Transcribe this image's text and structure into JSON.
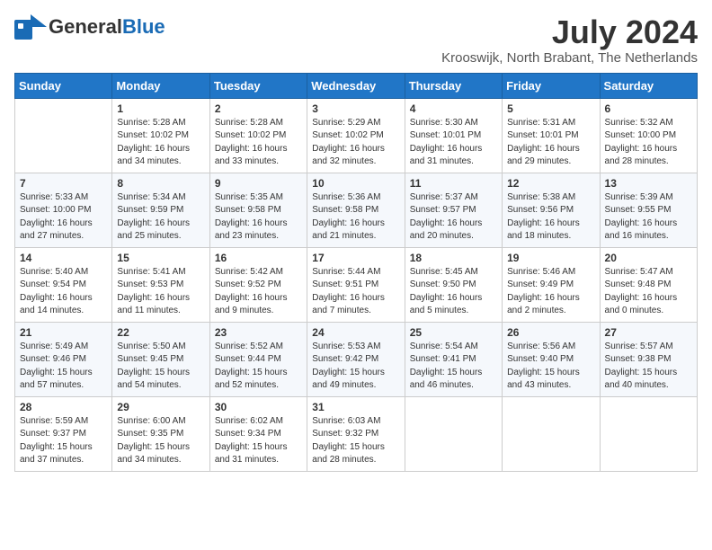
{
  "header": {
    "logo_general": "General",
    "logo_blue": "Blue",
    "month_year": "July 2024",
    "location": "Krooswijk, North Brabant, The Netherlands"
  },
  "weekdays": [
    "Sunday",
    "Monday",
    "Tuesday",
    "Wednesday",
    "Thursday",
    "Friday",
    "Saturday"
  ],
  "weeks": [
    [
      {
        "day": "",
        "text": ""
      },
      {
        "day": "1",
        "text": "Sunrise: 5:28 AM\nSunset: 10:02 PM\nDaylight: 16 hours\nand 34 minutes."
      },
      {
        "day": "2",
        "text": "Sunrise: 5:28 AM\nSunset: 10:02 PM\nDaylight: 16 hours\nand 33 minutes."
      },
      {
        "day": "3",
        "text": "Sunrise: 5:29 AM\nSunset: 10:02 PM\nDaylight: 16 hours\nand 32 minutes."
      },
      {
        "day": "4",
        "text": "Sunrise: 5:30 AM\nSunset: 10:01 PM\nDaylight: 16 hours\nand 31 minutes."
      },
      {
        "day": "5",
        "text": "Sunrise: 5:31 AM\nSunset: 10:01 PM\nDaylight: 16 hours\nand 29 minutes."
      },
      {
        "day": "6",
        "text": "Sunrise: 5:32 AM\nSunset: 10:00 PM\nDaylight: 16 hours\nand 28 minutes."
      }
    ],
    [
      {
        "day": "7",
        "text": "Sunrise: 5:33 AM\nSunset: 10:00 PM\nDaylight: 16 hours\nand 27 minutes."
      },
      {
        "day": "8",
        "text": "Sunrise: 5:34 AM\nSunset: 9:59 PM\nDaylight: 16 hours\nand 25 minutes."
      },
      {
        "day": "9",
        "text": "Sunrise: 5:35 AM\nSunset: 9:58 PM\nDaylight: 16 hours\nand 23 minutes."
      },
      {
        "day": "10",
        "text": "Sunrise: 5:36 AM\nSunset: 9:58 PM\nDaylight: 16 hours\nand 21 minutes."
      },
      {
        "day": "11",
        "text": "Sunrise: 5:37 AM\nSunset: 9:57 PM\nDaylight: 16 hours\nand 20 minutes."
      },
      {
        "day": "12",
        "text": "Sunrise: 5:38 AM\nSunset: 9:56 PM\nDaylight: 16 hours\nand 18 minutes."
      },
      {
        "day": "13",
        "text": "Sunrise: 5:39 AM\nSunset: 9:55 PM\nDaylight: 16 hours\nand 16 minutes."
      }
    ],
    [
      {
        "day": "14",
        "text": "Sunrise: 5:40 AM\nSunset: 9:54 PM\nDaylight: 16 hours\nand 14 minutes."
      },
      {
        "day": "15",
        "text": "Sunrise: 5:41 AM\nSunset: 9:53 PM\nDaylight: 16 hours\nand 11 minutes."
      },
      {
        "day": "16",
        "text": "Sunrise: 5:42 AM\nSunset: 9:52 PM\nDaylight: 16 hours\nand 9 minutes."
      },
      {
        "day": "17",
        "text": "Sunrise: 5:44 AM\nSunset: 9:51 PM\nDaylight: 16 hours\nand 7 minutes."
      },
      {
        "day": "18",
        "text": "Sunrise: 5:45 AM\nSunset: 9:50 PM\nDaylight: 16 hours\nand 5 minutes."
      },
      {
        "day": "19",
        "text": "Sunrise: 5:46 AM\nSunset: 9:49 PM\nDaylight: 16 hours\nand 2 minutes."
      },
      {
        "day": "20",
        "text": "Sunrise: 5:47 AM\nSunset: 9:48 PM\nDaylight: 16 hours\nand 0 minutes."
      }
    ],
    [
      {
        "day": "21",
        "text": "Sunrise: 5:49 AM\nSunset: 9:46 PM\nDaylight: 15 hours\nand 57 minutes."
      },
      {
        "day": "22",
        "text": "Sunrise: 5:50 AM\nSunset: 9:45 PM\nDaylight: 15 hours\nand 54 minutes."
      },
      {
        "day": "23",
        "text": "Sunrise: 5:52 AM\nSunset: 9:44 PM\nDaylight: 15 hours\nand 52 minutes."
      },
      {
        "day": "24",
        "text": "Sunrise: 5:53 AM\nSunset: 9:42 PM\nDaylight: 15 hours\nand 49 minutes."
      },
      {
        "day": "25",
        "text": "Sunrise: 5:54 AM\nSunset: 9:41 PM\nDaylight: 15 hours\nand 46 minutes."
      },
      {
        "day": "26",
        "text": "Sunrise: 5:56 AM\nSunset: 9:40 PM\nDaylight: 15 hours\nand 43 minutes."
      },
      {
        "day": "27",
        "text": "Sunrise: 5:57 AM\nSunset: 9:38 PM\nDaylight: 15 hours\nand 40 minutes."
      }
    ],
    [
      {
        "day": "28",
        "text": "Sunrise: 5:59 AM\nSunset: 9:37 PM\nDaylight: 15 hours\nand 37 minutes."
      },
      {
        "day": "29",
        "text": "Sunrise: 6:00 AM\nSunset: 9:35 PM\nDaylight: 15 hours\nand 34 minutes."
      },
      {
        "day": "30",
        "text": "Sunrise: 6:02 AM\nSunset: 9:34 PM\nDaylight: 15 hours\nand 31 minutes."
      },
      {
        "day": "31",
        "text": "Sunrise: 6:03 AM\nSunset: 9:32 PM\nDaylight: 15 hours\nand 28 minutes."
      },
      {
        "day": "",
        "text": ""
      },
      {
        "day": "",
        "text": ""
      },
      {
        "day": "",
        "text": ""
      }
    ]
  ]
}
